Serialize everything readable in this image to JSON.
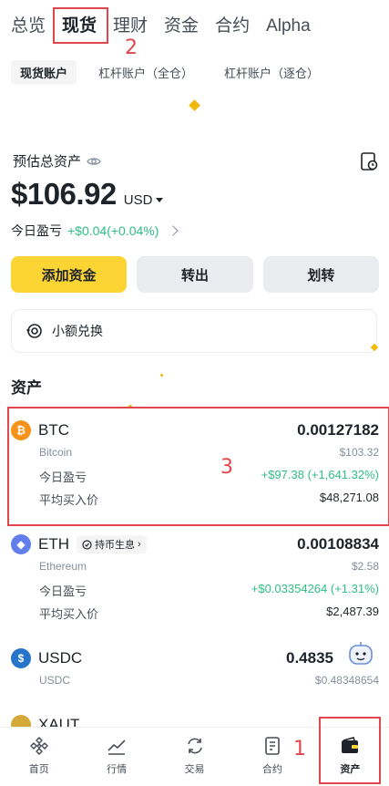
{
  "top_tabs": [
    {
      "label": "总览",
      "active": false
    },
    {
      "label": "现货",
      "active": true
    },
    {
      "label": "理财",
      "active": false
    },
    {
      "label": "资金",
      "active": false
    },
    {
      "label": "合约",
      "active": false
    },
    {
      "label": "Alpha",
      "active": false
    }
  ],
  "sub_tabs": [
    {
      "label": "现货账户",
      "active": true
    },
    {
      "label": "杠杆账户（全仓）",
      "active": false
    },
    {
      "label": "杠杆账户（逐仓）",
      "active": false
    }
  ],
  "summary": {
    "est_label": "预估总资产",
    "balance": "$106.92",
    "currency": "USD",
    "pnl_label": "今日盈亏",
    "pnl_value": "+$0.04(+0.04%)"
  },
  "actions": {
    "deposit": "添加资金",
    "withdraw": "转出",
    "transfer": "划转"
  },
  "swap_card": {
    "label": "小额兑换"
  },
  "assets_section": {
    "title": "资产"
  },
  "assets": [
    {
      "symbol": "BTC",
      "name": "Bitcoin",
      "qty": "0.00127182",
      "usd": "$103.32",
      "pnl_label": "今日盈亏",
      "pnl_value": "+$97.38 (+1,641.32%)",
      "avg_label": "平均买入价",
      "avg_value": "$48,271.08",
      "icon_color": "#f7931a",
      "icon_glyph": "₿"
    },
    {
      "symbol": "ETH",
      "name": "Ethereum",
      "tag": "持币生息",
      "qty": "0.00108834",
      "usd": "$2.58",
      "pnl_label": "今日盈亏",
      "pnl_value": "+$0.03354264 (+1.31%)",
      "avg_label": "平均买入价",
      "avg_value": "$2,487.39",
      "icon_color": "#627eea",
      "icon_glyph": "◆"
    },
    {
      "symbol": "USDC",
      "name": "USDC",
      "qty": "0.4835",
      "usd": "$0.48348654",
      "icon_color": "#2775ca",
      "icon_glyph": "$"
    },
    {
      "symbol": "XAUT",
      "icon_color": "#d4a93a"
    }
  ],
  "bottom_nav": [
    {
      "label": "首页",
      "icon": "binance-home-icon"
    },
    {
      "label": "行情",
      "icon": "market-chart-icon"
    },
    {
      "label": "交易",
      "icon": "trade-swap-icon"
    },
    {
      "label": "合约",
      "icon": "futures-doc-icon"
    },
    {
      "label": "资产",
      "icon": "wallet-icon",
      "active": true
    }
  ],
  "annotations": {
    "n1": "1",
    "n2": "2",
    "n3": "3"
  },
  "colors": {
    "accent": "#fcd535",
    "profit": "#2ebd85",
    "annotation": "#e0474c"
  }
}
